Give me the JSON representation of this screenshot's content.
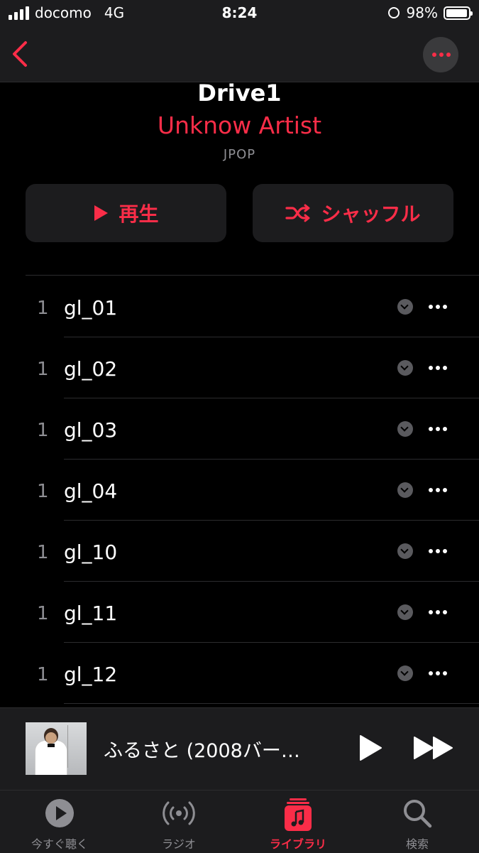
{
  "status_bar": {
    "carrier": "docomo",
    "network": "4G",
    "time": "8:24",
    "battery_percent": "98%",
    "battery_level": 0.98
  },
  "header": {
    "title": "Drive1",
    "artist": "Unknow Artist",
    "genre": "JPOP"
  },
  "actions": {
    "play_label": "再生",
    "shuffle_label": "シャッフル"
  },
  "tracks": [
    {
      "num": "1",
      "name": "gl_01"
    },
    {
      "num": "1",
      "name": "gl_02"
    },
    {
      "num": "1",
      "name": "gl_03"
    },
    {
      "num": "1",
      "name": "gl_04"
    },
    {
      "num": "1",
      "name": "gl_10"
    },
    {
      "num": "1",
      "name": "gl_11"
    },
    {
      "num": "1",
      "name": "gl_12"
    }
  ],
  "now_playing": {
    "title": "ふるさと (2008バー…"
  },
  "tabbar": {
    "tabs": [
      {
        "label": "今すぐ聴く",
        "icon": "play-circle-icon"
      },
      {
        "label": "ラジオ",
        "icon": "radio-icon"
      },
      {
        "label": "ライブラリ",
        "icon": "library-icon"
      },
      {
        "label": "検索",
        "icon": "search-icon"
      }
    ],
    "active_index": 2
  },
  "colors": {
    "accent": "#fa2d48",
    "background": "#000000",
    "surface": "#1c1c1e",
    "secondary_text": "#8e8e93"
  }
}
